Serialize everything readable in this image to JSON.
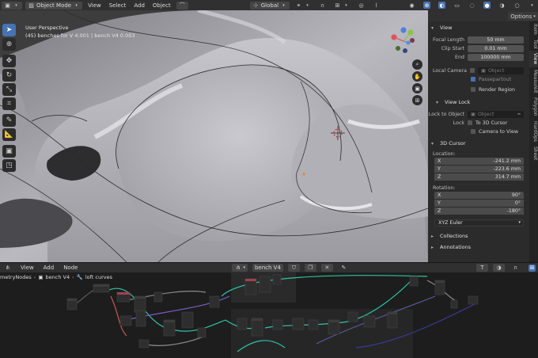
{
  "header": {
    "mode_label": "Object Mode",
    "menus": [
      "View",
      "Select",
      "Add",
      "Object"
    ],
    "orientation_label": "Global",
    "options_label": "Options"
  },
  "viewport": {
    "perspective_label": "User Perspective",
    "object_info": "(45) benches for V 4.001 | bench V4 0.003"
  },
  "npanel": {
    "view_section": "View",
    "focal_length_label": "Focal Length",
    "focal_length_value": "50 mm",
    "clip_start_label": "Clip Start",
    "clip_start_value": "0.01 mm",
    "clip_end_label": "End",
    "clip_end_value": "100000 mm",
    "local_camera_label": "Local Camera",
    "local_camera_placeholder": "Object",
    "passepartout_label": "Passepartout",
    "render_region_label": "Render Region",
    "view_lock_section": "View Lock",
    "lock_to_object_label": "Lock to Object",
    "lock_to_object_placeholder": "Object",
    "lock_label": "Lock",
    "to_3d_cursor_label": "To 3D Cursor",
    "camera_to_view_label": "Camera to View",
    "cursor_section": "3D Cursor",
    "location_label": "Location:",
    "loc_x_label": "X",
    "loc_x": "-241.2 mm",
    "loc_y_label": "Y",
    "loc_y": "-223.6 mm",
    "loc_z_label": "Z",
    "loc_z": "314.7 mm",
    "rotation_label": "Rotation:",
    "rot_x_label": "X",
    "rot_x": "90°",
    "rot_y_label": "Y",
    "rot_y": "0°",
    "rot_z_label": "Z",
    "rot_z": "-180°",
    "rotation_mode": "XYZ Euler",
    "collections_section": "Collections",
    "annotations_section": "Annotations"
  },
  "side_tabs": [
    "Item",
    "Tool",
    "View",
    "Measureit",
    "Polygon",
    "HardOps",
    "Sheet"
  ],
  "node_editor": {
    "menus": [
      "View",
      "Add",
      "Node"
    ],
    "tree_name": "bench V4",
    "breadcrumb_root": "GeometryNodes",
    "breadcrumb_object": "bench V4",
    "breadcrumb_modifier": "loft curves"
  }
}
